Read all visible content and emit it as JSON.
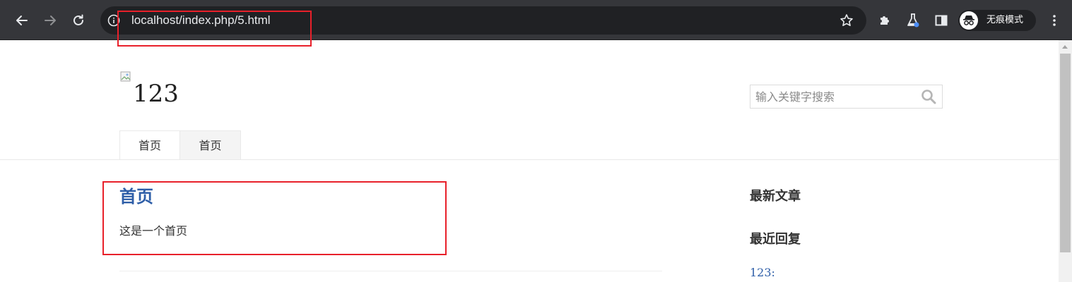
{
  "browser": {
    "url": "localhost/index.php/5.html",
    "profile_label": "无痕模式"
  },
  "site": {
    "logo_alt": "123",
    "search_placeholder": "输入关键字搜索",
    "nav": [
      {
        "label": "首页"
      },
      {
        "label": "首页"
      }
    ]
  },
  "post": {
    "title": "首页",
    "body": "这是一个首页"
  },
  "sidebar": {
    "latest_posts_title": "最新文章",
    "recent_replies_title": "最近回复",
    "recent_comment": "123:"
  },
  "colors": {
    "chrome_bg": "#35363a",
    "omnibox_bg": "#202124",
    "link_blue": "#2e5ea8",
    "annotation_red": "#e8202a"
  }
}
